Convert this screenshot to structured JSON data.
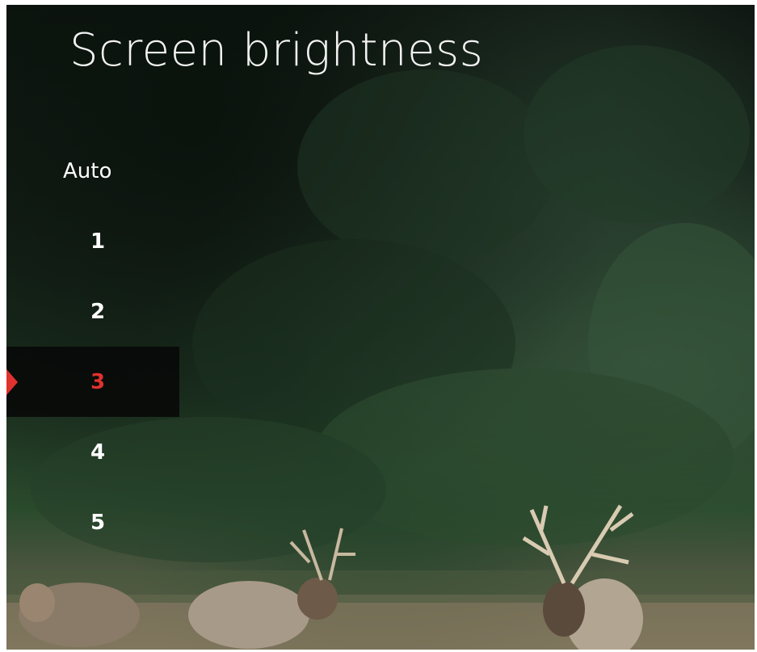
{
  "title": "Screen brightness",
  "options": [
    {
      "label": "Auto"
    },
    {
      "label": "1"
    },
    {
      "label": "2"
    },
    {
      "label": "3",
      "selected": true
    },
    {
      "label": "4"
    },
    {
      "label": "5"
    }
  ],
  "colors": {
    "accent": "#e0322e",
    "text": "#ffffff"
  }
}
